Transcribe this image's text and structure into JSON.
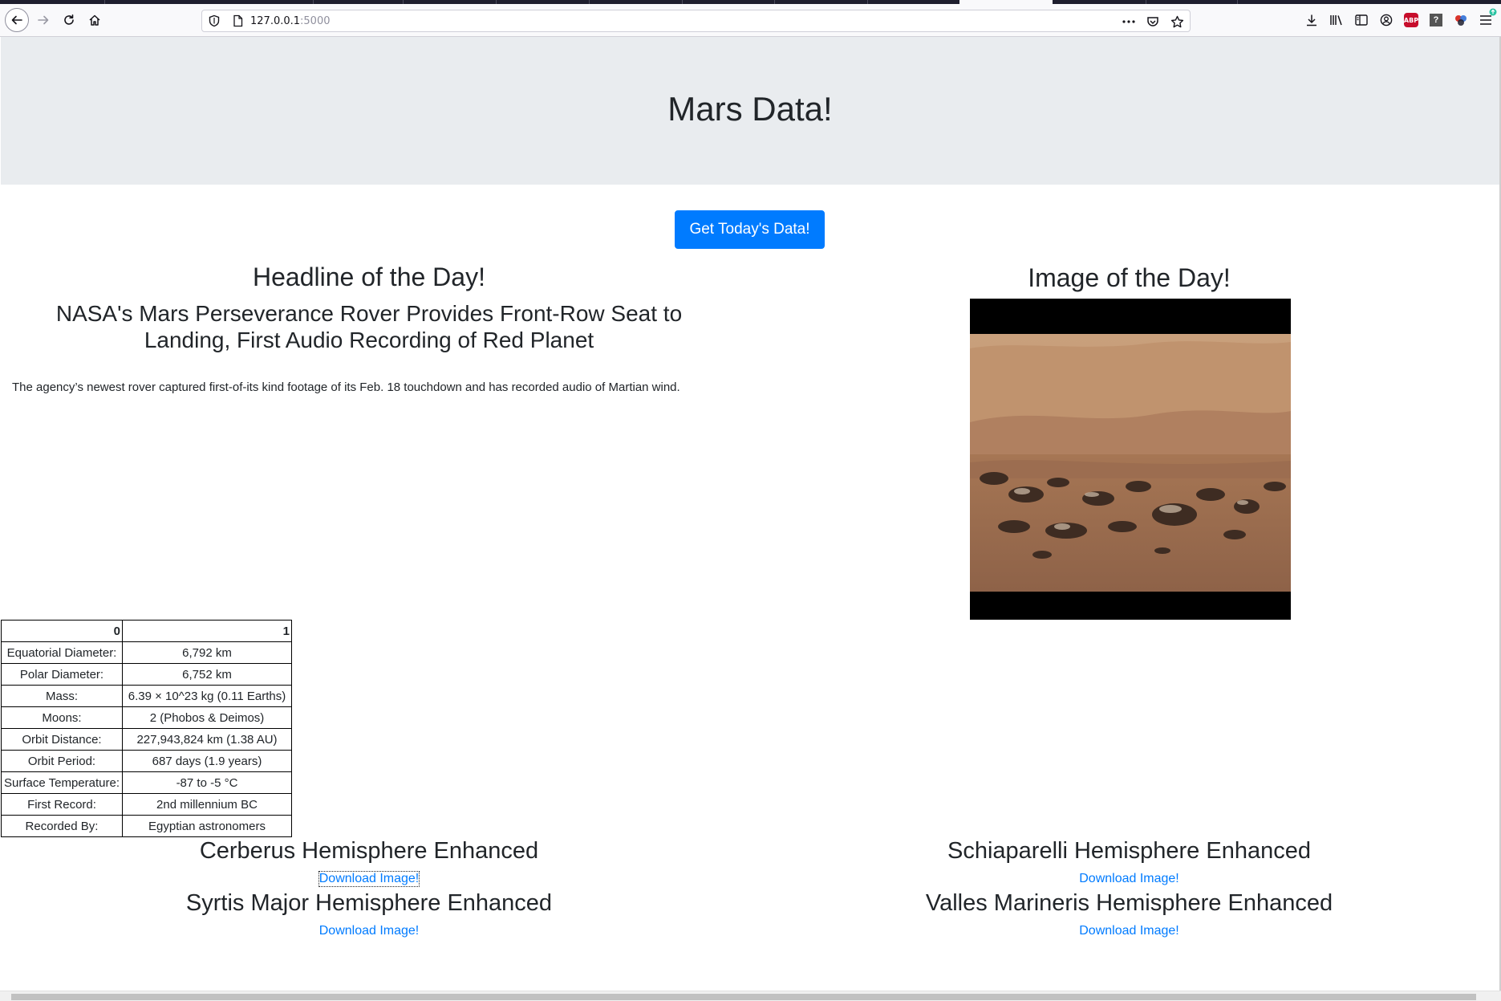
{
  "browser": {
    "url_host": "127.0.0.1",
    "url_port": ":5000"
  },
  "header": {
    "title": "Mars Data!"
  },
  "scrape_button": {
    "label": "Get Today's Data!"
  },
  "news": {
    "section_title": "Headline of the Day!",
    "headline": "NASA's Mars Perseverance Rover Provides Front-Row Seat to Landing, First Audio Recording of Red Planet",
    "teaser": "The agency’s newest rover captured first-of-its kind footage of its Feb. 18 touchdown and has recorded audio of Martian wind."
  },
  "featured_image": {
    "section_title": "Image of the Day!"
  },
  "facts_table": {
    "headers": [
      "0",
      "1"
    ],
    "rows": [
      {
        "label": "Equatorial Diameter:",
        "value": "6,792 km"
      },
      {
        "label": "Polar Diameter:",
        "value": "6,752 km"
      },
      {
        "label": "Mass:",
        "value": "6.39 × 10^23 kg (0.11 Earths)"
      },
      {
        "label": "Moons:",
        "value": "2 (Phobos & Deimos)"
      },
      {
        "label": "Orbit Distance:",
        "value": "227,943,824 km (1.38 AU)"
      },
      {
        "label": "Orbit Period:",
        "value": "687 days (1.9 years)"
      },
      {
        "label": "Surface Temperature:",
        "value": "-87 to -5 °C"
      },
      {
        "label": "First Record:",
        "value": "2nd millennium BC"
      },
      {
        "label": "Recorded By:",
        "value": "Egyptian astronomers"
      }
    ]
  },
  "hemispheres": [
    {
      "title": "Cerberus Hemisphere Enhanced",
      "link": "Download Image!"
    },
    {
      "title": "Schiaparelli Hemisphere Enhanced",
      "link": "Download Image!"
    },
    {
      "title": "Syrtis Major Hemisphere Enhanced",
      "link": "Download Image!"
    },
    {
      "title": "Valles Marineris Hemisphere Enhanced",
      "link": "Download Image!"
    }
  ]
}
